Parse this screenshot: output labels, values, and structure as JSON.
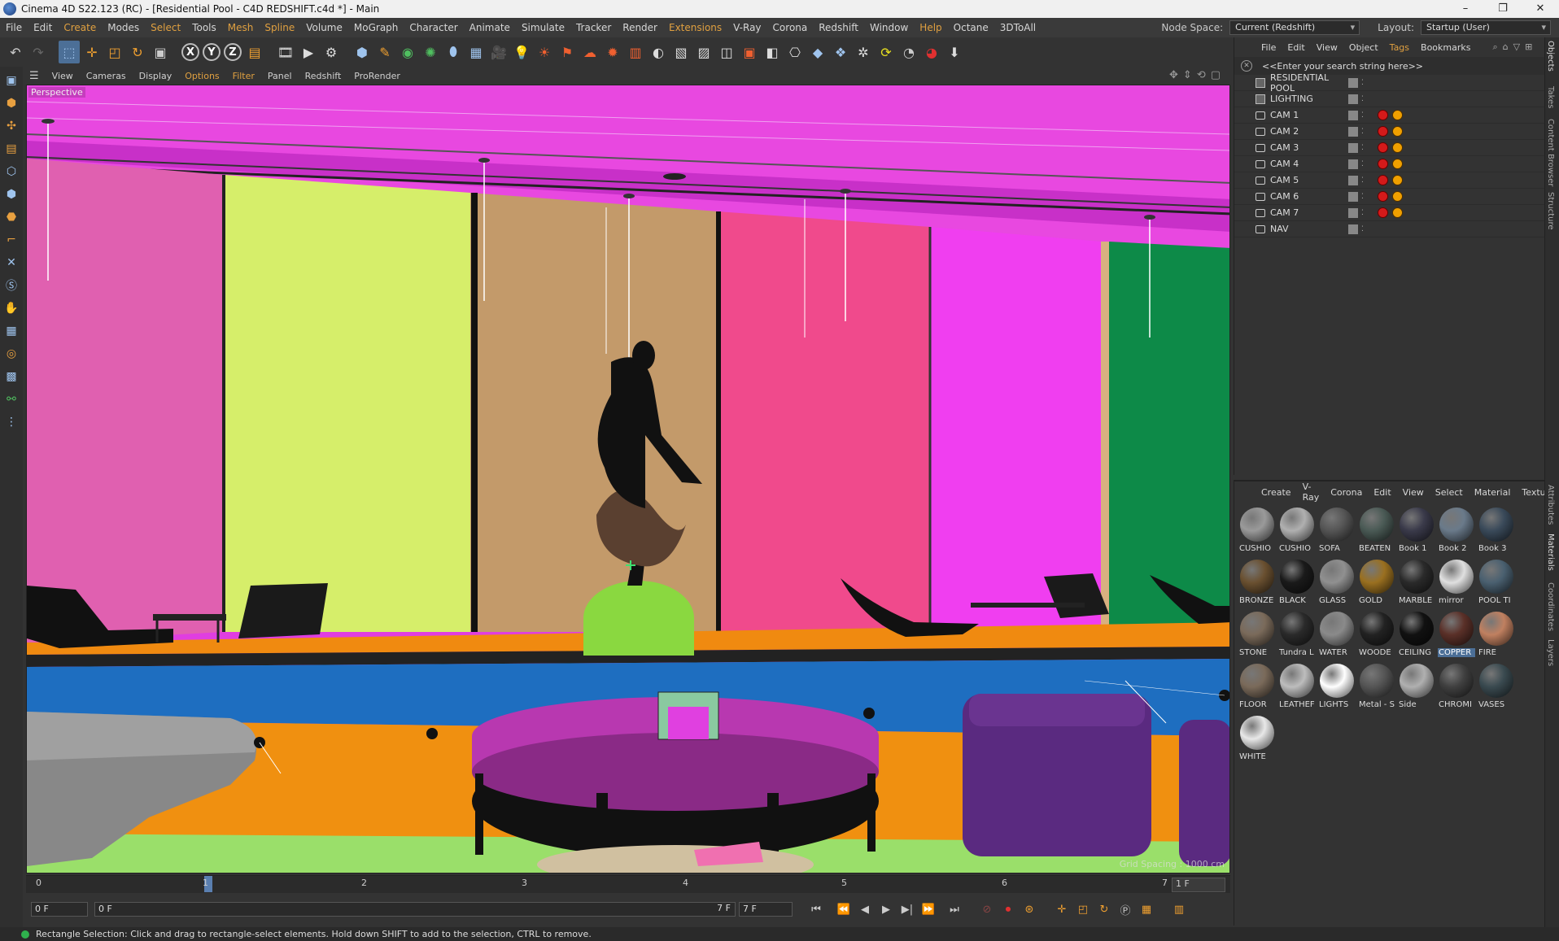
{
  "window": {
    "title": "Cinema 4D S22.123 (RC) - [Residential Pool - C4D REDSHIFT.c4d *] - Main",
    "controls": [
      "–",
      "❐",
      "✕"
    ]
  },
  "menubar": {
    "items": [
      "File",
      "Edit",
      "Create",
      "Modes",
      "Select",
      "Tools",
      "Mesh",
      "Spline",
      "Volume",
      "MoGraph",
      "Character",
      "Animate",
      "Simulate",
      "Tracker",
      "Render",
      "Extensions",
      "V-Ray",
      "Corona",
      "Redshift",
      "Window",
      "Help",
      "Octane",
      "3DToAll"
    ],
    "node_space_label": "Node Space:",
    "node_space_value": "Current (Redshift)",
    "layout_label": "Layout:",
    "layout_value": "Startup (User)"
  },
  "toolbar": {
    "axis_labels": [
      "X",
      "Y",
      "Z"
    ]
  },
  "viewport": {
    "menu": [
      "View",
      "Cameras",
      "Display",
      "Options",
      "Filter",
      "Panel",
      "Redshift",
      "ProRender"
    ],
    "camera_label": "Perspective",
    "grid_spacing": "Grid Spacing : 1000 cm"
  },
  "timeline": {
    "ticks": [
      "0",
      "1",
      "2",
      "3",
      "4",
      "5",
      "6",
      "7"
    ],
    "end_frame": "1 F"
  },
  "transport": {
    "current_frame": "0 F",
    "range_start": "0 F",
    "range_end": "7 F",
    "max_frame": "7 F"
  },
  "status": {
    "message": "Rectangle Selection: Click and drag to rectangle-select elements. Hold down SHIFT to add to the selection, CTRL to remove."
  },
  "object_manager": {
    "menu": [
      "File",
      "Edit",
      "View",
      "Object",
      "Tags",
      "Bookmarks"
    ],
    "search_placeholder": "<<Enter your search string here>>",
    "objects": [
      {
        "name": "RESIDENTIAL POOL",
        "type": "null",
        "tags": false
      },
      {
        "name": "LIGHTING",
        "type": "null",
        "tags": false
      },
      {
        "name": "CAM 1",
        "type": "camera",
        "tags": true
      },
      {
        "name": "CAM 2",
        "type": "camera",
        "tags": true
      },
      {
        "name": "CAM 3",
        "type": "camera",
        "tags": true
      },
      {
        "name": "CAM 4",
        "type": "camera",
        "tags": true
      },
      {
        "name": "CAM 5",
        "type": "camera",
        "tags": true
      },
      {
        "name": "CAM 6",
        "type": "camera",
        "tags": true
      },
      {
        "name": "CAM 7",
        "type": "camera",
        "tags": true
      },
      {
        "name": "NAV",
        "type": "camera",
        "tags": false
      }
    ]
  },
  "material_manager": {
    "menu": [
      "Create",
      "V-Ray",
      "Corona",
      "Edit",
      "View",
      "Select",
      "Material",
      "Textu"
    ],
    "materials": [
      {
        "label": "CUSHIO",
        "color": "#9a9a9a"
      },
      {
        "label": "CUSHIO",
        "color": "#b0b0b0"
      },
      {
        "label": "SOFA",
        "color": "#555555"
      },
      {
        "label": "BEATEN",
        "color": "#4a5a55"
      },
      {
        "label": "Book 1",
        "color": "#3a3a4a"
      },
      {
        "label": "Book 2",
        "color": "#6a7a8a"
      },
      {
        "label": "Book 3",
        "color": "#3a4a5a"
      },
      {
        "label": "BRONZE",
        "color": "#6a5030"
      },
      {
        "label": "BLACK",
        "color": "#1a1a1a"
      },
      {
        "label": "GLASS",
        "color": "#909090"
      },
      {
        "label": "GOLD",
        "color": "#9a7020"
      },
      {
        "label": "MARBLE",
        "color": "#2a2a2a"
      },
      {
        "label": "mirror",
        "color": "#e0e0e0"
      },
      {
        "label": "POOL TI",
        "color": "#4a6070"
      },
      {
        "label": "STONE",
        "color": "#7a6a5a"
      },
      {
        "label": "Tundra L",
        "color": "#2a2a2a"
      },
      {
        "label": "WATER",
        "color": "#8a8a8a"
      },
      {
        "label": "WOODE",
        "color": "#222222"
      },
      {
        "label": "CEILING",
        "color": "#111111"
      },
      {
        "label": "COPPER",
        "color": "#5a3028",
        "selected": true
      },
      {
        "label": "FIRE",
        "color": "#c08060"
      },
      {
        "label": "FLOOR",
        "color": "#7a6a5a"
      },
      {
        "label": "LEATHEF",
        "color": "#bdbdbd"
      },
      {
        "label": "LIGHTS",
        "color": "#ffffff"
      },
      {
        "label": "Metal - S",
        "color": "#555555"
      },
      {
        "label": "Side",
        "color": "#b0b0b0"
      },
      {
        "label": "CHROMI",
        "color": "#404040"
      },
      {
        "label": "VASES",
        "color": "#3a4a50"
      },
      {
        "label": "WHITE",
        "color": "#e8e8e8"
      }
    ]
  },
  "side_tabs": [
    "Objects",
    "Takes",
    "Content Browser",
    "Structure",
    "Attributes",
    "Materials",
    "Coordinates",
    "Layers"
  ]
}
